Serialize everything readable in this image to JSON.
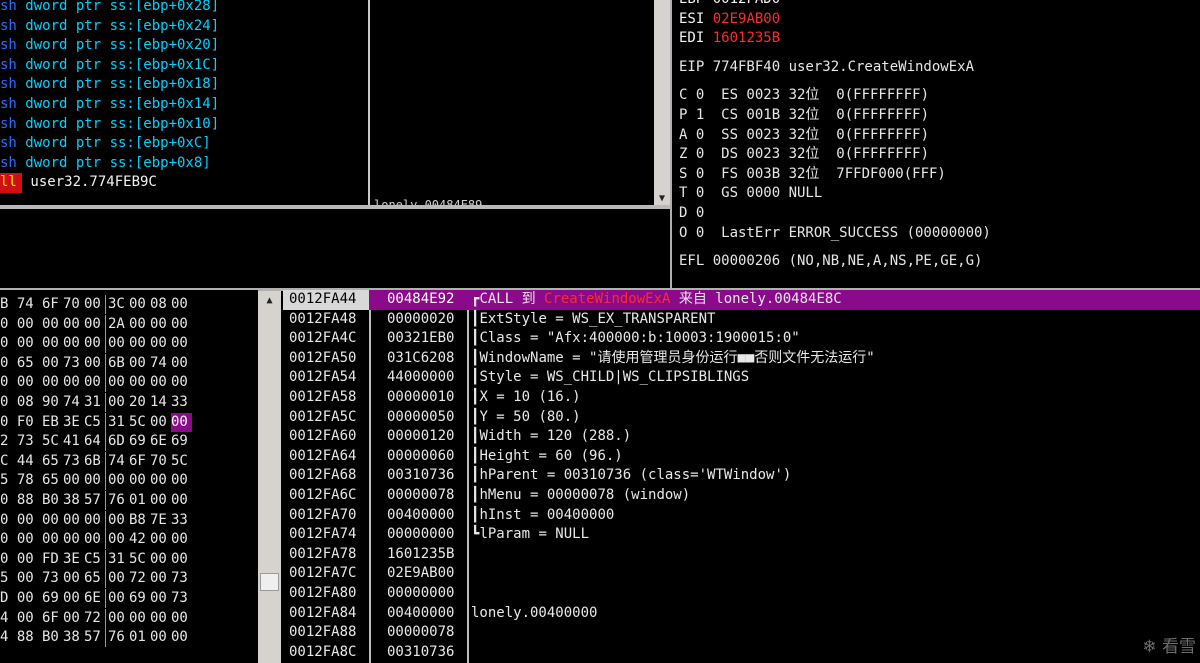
{
  "disassembly": {
    "lines": [
      {
        "prefix": "sh",
        "operand": " dword ptr ss:[ebp+0x28]"
      },
      {
        "prefix": "sh",
        "operand": " dword ptr ss:[ebp+0x24]"
      },
      {
        "prefix": "sh",
        "operand": " dword ptr ss:[ebp+0x20]"
      },
      {
        "prefix": "sh",
        "operand": " dword ptr ss:[ebp+0x1C]"
      },
      {
        "prefix": "sh",
        "operand": " dword ptr ss:[ebp+0x18]"
      },
      {
        "prefix": "sh",
        "operand": " dword ptr ss:[ebp+0x14]"
      },
      {
        "prefix": "sh",
        "operand": " dword ptr ss:[ebp+0x10]"
      },
      {
        "prefix": "sh",
        "operand": " dword ptr ss:[ebp+0xC]"
      },
      {
        "prefix": "sh",
        "operand": " dword ptr ss:[ebp+0x8]"
      }
    ],
    "call_line": {
      "badge": "ll",
      "operand": " user32.774FEB9C"
    }
  },
  "disassembly_partial_text": "lonely.00484E89",
  "registers": {
    "lines": [
      {
        "name": "ESI",
        "value": "02E9AB00",
        "changed": true
      },
      {
        "name": "EDI",
        "value": "1601235B",
        "changed": true
      }
    ],
    "eip": "EIP 774FBF40 user32.CreateWindowExA",
    "flags": [
      "C 0  ES 0023 32位  0(FFFFFFFF)",
      "P 1  CS 001B 32位  0(FFFFFFFF)",
      "A 0  SS 0023 32位  0(FFFFFFFF)",
      "Z 0  DS 0023 32位  0(FFFFFFFF)",
      "S 0  FS 003B 32位  7FFDF000(FFF)",
      "T 0  GS 0000 NULL",
      "D 0",
      "O 0  LastErr ERROR_SUCCESS (00000000)"
    ],
    "efl": "EFL 00000206 (NO,NB,NE,A,NS,PE,GE,G)"
  },
  "hexdump": {
    "rows": [
      [
        "B 74",
        "6F",
        "70",
        "00",
        "3C",
        "00",
        "08",
        "00"
      ],
      [
        "0 00",
        "00",
        "00",
        "00",
        "2A",
        "00",
        "00",
        "00"
      ],
      [
        "0 00",
        "00",
        "00",
        "00",
        "00",
        "00",
        "00",
        "00"
      ],
      [
        "0 65",
        "00",
        "73",
        "00",
        "6B",
        "00",
        "74",
        "00"
      ],
      [
        "0 00",
        "00",
        "00",
        "00",
        "00",
        "00",
        "00",
        "00"
      ],
      [
        "0 08",
        "90",
        "74",
        "31",
        "00",
        "20",
        "14",
        "33"
      ],
      [
        "0 F0",
        "EB",
        "3E",
        "C5",
        "31",
        "5C",
        "00",
        "00"
      ],
      [
        "2 73",
        "5C",
        "41",
        "64",
        "6D",
        "69",
        "6E",
        "69"
      ],
      [
        "C 44",
        "65",
        "73",
        "6B",
        "74",
        "6F",
        "70",
        "5C"
      ],
      [
        "5 78",
        "65",
        "00",
        "00",
        "00",
        "00",
        "00",
        "00"
      ],
      [
        "0 88",
        "B0",
        "38",
        "57",
        "76",
        "01",
        "00",
        "00"
      ],
      [
        "0 00",
        "00",
        "00",
        "00",
        "00",
        "B8",
        "7E",
        "33"
      ],
      [
        "0 00",
        "00",
        "00",
        "00",
        "00",
        "42",
        "00",
        "00"
      ],
      [
        "0 00",
        "FD",
        "3E",
        "C5",
        "31",
        "5C",
        "00",
        "00"
      ],
      [
        "5 00",
        "73",
        "00",
        "65",
        "00",
        "72",
        "00",
        "73"
      ],
      [
        "D 00",
        "69",
        "00",
        "6E",
        "00",
        "69",
        "00",
        "73"
      ],
      [
        "4 00",
        "6F",
        "00",
        "72",
        "00",
        "00",
        "00",
        "00"
      ],
      [
        "4 88",
        "B0",
        "38",
        "57",
        "76",
        "01",
        "00",
        "00"
      ]
    ]
  },
  "stack": {
    "rows": [
      {
        "addr": "0012FA44",
        "val": "00484E92",
        "brace": "┏",
        "cmt": "CALL 到 ",
        "api": "CreateWindowExA",
        "tail": " 来自 lonely.00484E8C"
      },
      {
        "addr": "0012FA48",
        "val": "00000020",
        "brace": "┃",
        "cmt": "ExtStyle = WS_EX_TRANSPARENT"
      },
      {
        "addr": "0012FA4C",
        "val": "00321EB0",
        "brace": "┃",
        "cmt": "Class = \"Afx:400000:b:10003:1900015:0\""
      },
      {
        "addr": "0012FA50",
        "val": "031C6208",
        "brace": "┃",
        "cmt": "WindowName = \"请使用管理员身份运行■■否则文件无法运行\""
      },
      {
        "addr": "0012FA54",
        "val": "44000000",
        "brace": "┃",
        "cmt": "Style = WS_CHILD|WS_CLIPSIBLINGS"
      },
      {
        "addr": "0012FA58",
        "val": "00000010",
        "brace": "┃",
        "cmt": "X = 10 (16.)"
      },
      {
        "addr": "0012FA5C",
        "val": "00000050",
        "brace": "┃",
        "cmt": "Y = 50 (80.)"
      },
      {
        "addr": "0012FA60",
        "val": "00000120",
        "brace": "┃",
        "cmt": "Width = 120 (288.)"
      },
      {
        "addr": "0012FA64",
        "val": "00000060",
        "brace": "┃",
        "cmt": "Height = 60 (96.)"
      },
      {
        "addr": "0012FA68",
        "val": "00310736",
        "brace": "┃",
        "cmt": "hParent = 00310736 (class='WTWindow')"
      },
      {
        "addr": "0012FA6C",
        "val": "00000078",
        "brace": "┃",
        "cmt": "hMenu = 00000078 (window)"
      },
      {
        "addr": "0012FA70",
        "val": "00400000",
        "brace": "┃",
        "cmt": "hInst = 00400000"
      },
      {
        "addr": "0012FA74",
        "val": "00000000",
        "brace": "┗",
        "cmt": "lParam = NULL"
      },
      {
        "addr": "0012FA78",
        "val": "1601235B",
        "brace": "",
        "cmt": ""
      },
      {
        "addr": "0012FA7C",
        "val": "02E9AB00",
        "brace": "",
        "cmt": ""
      },
      {
        "addr": "0012FA80",
        "val": "00000000",
        "brace": "",
        "cmt": ""
      },
      {
        "addr": "0012FA84",
        "val": "00400000",
        "brace": "",
        "cmt": "lonely.00400000"
      },
      {
        "addr": "0012FA88",
        "val": "00000078",
        "brace": "",
        "cmt": ""
      },
      {
        "addr": "0012FA8C",
        "val": "00310736",
        "brace": "",
        "cmt": ""
      }
    ]
  },
  "watermark": "看雪",
  "watermark_icon": "snowflake-icon",
  "colors": {
    "selection": "#8b0a8b",
    "changed_register": "#ff2b2b",
    "instruction": "#00d2ff"
  }
}
